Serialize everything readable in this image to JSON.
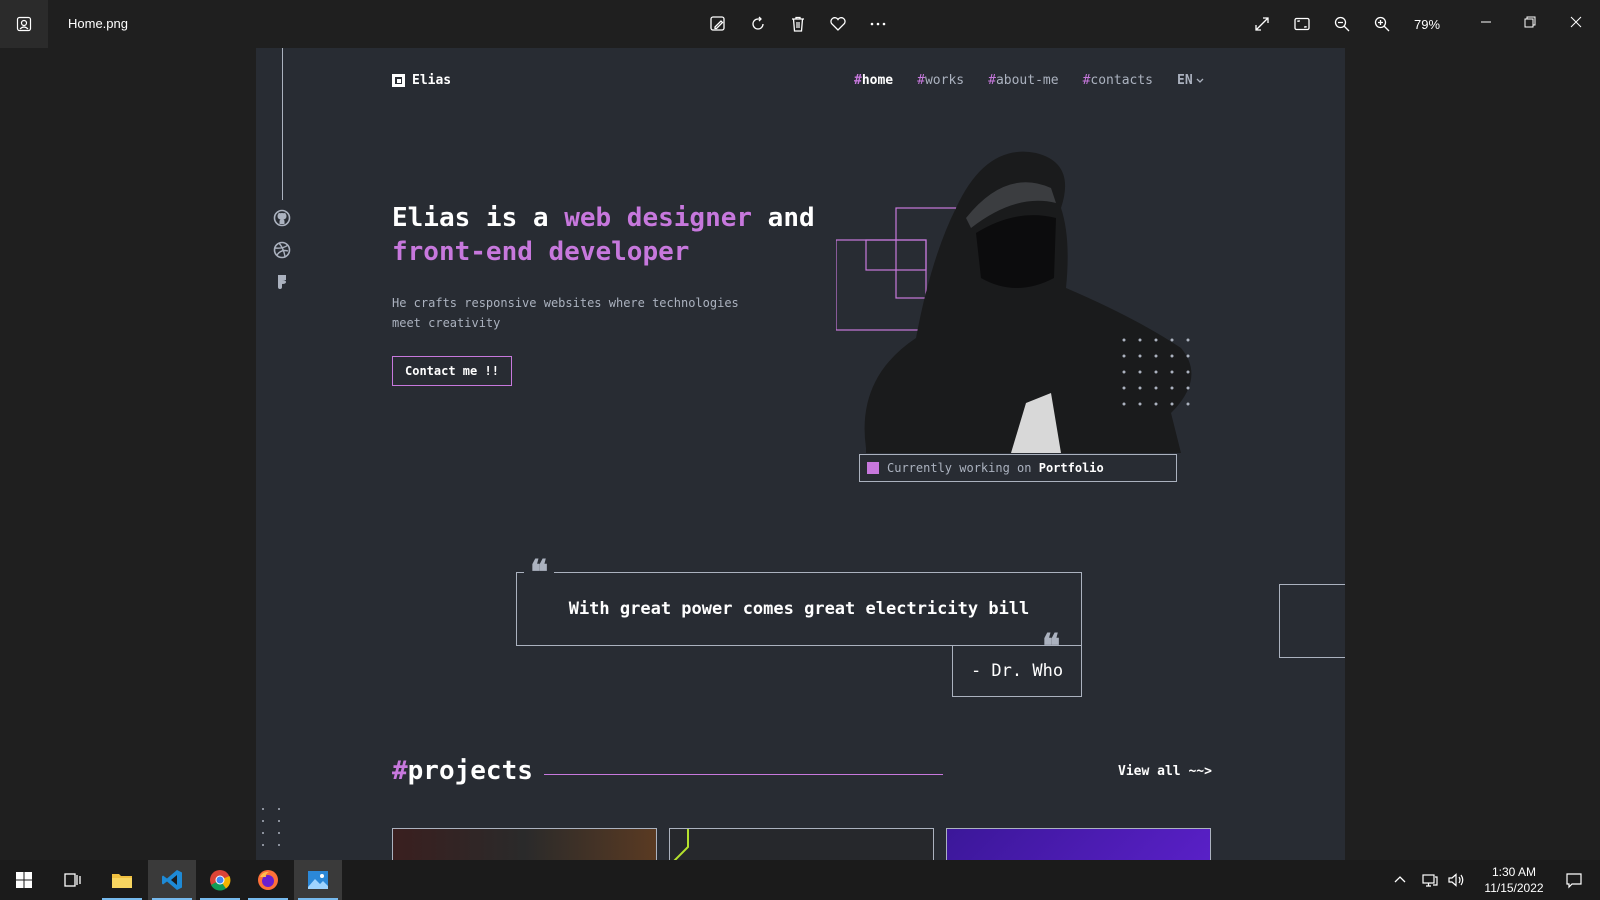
{
  "window": {
    "filename": "Home.png",
    "zoom": "79%",
    "tools": [
      "edit-image-icon",
      "rotate-icon",
      "delete-icon",
      "favorite-icon",
      "more-icon"
    ]
  },
  "page": {
    "logo_text": "Elias",
    "nav": [
      {
        "hash": "#",
        "label": "home",
        "active": true
      },
      {
        "hash": "#",
        "label": "works",
        "active": false
      },
      {
        "hash": "#",
        "label": "about-me",
        "active": false
      },
      {
        "hash": "#",
        "label": "contacts",
        "active": false
      }
    ],
    "language": "EN",
    "hero": {
      "t1": "Elias is a ",
      "t2": "web designer",
      "t3": " and ",
      "t4": "front-end developer",
      "subtitle": "He crafts responsive websites where technologies meet creativity",
      "cta": "Contact me !!"
    },
    "status": {
      "prefix": "Currently working on ",
      "project": "Portfolio"
    },
    "quote": {
      "text": "With great power comes great electricity bill",
      "author": "- Dr. Who",
      "mark": "❝"
    },
    "projects": {
      "hash": "#",
      "title": "projects",
      "view_all": "View all ~~>"
    },
    "colors": {
      "accent": "#c778dd",
      "bg": "#282c33",
      "gray": "#abb2bf"
    }
  },
  "taskbar": {
    "time": "1:30 AM",
    "date": "11/15/2022"
  }
}
